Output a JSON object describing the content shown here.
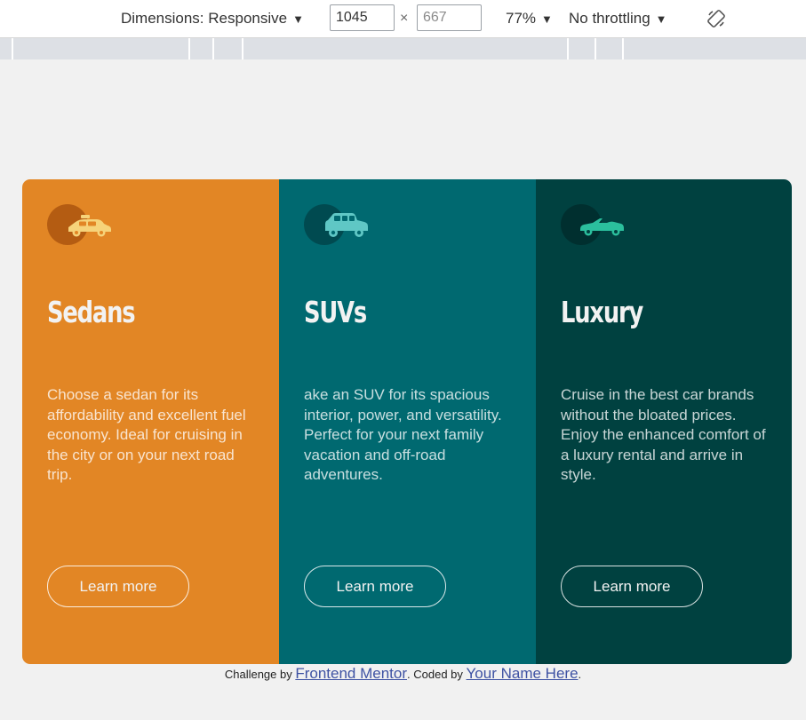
{
  "devtools": {
    "dimensions_label": "Dimensions: Responsive",
    "width_value": "1045",
    "height_placeholder": "667",
    "times": "×",
    "zoom": "77%",
    "throttling": "No throttling",
    "caret": "▼"
  },
  "cards": [
    {
      "icon": "sedan-car-icon",
      "title": "Sedans",
      "text": "Choose a sedan for its affordability and excellent fuel economy. Ideal for cruising in the city or on your next road trip.",
      "button": "Learn more",
      "color": "#e28625"
    },
    {
      "icon": "suv-car-icon",
      "title": "SUVs",
      "text": "ake an SUV for its spacious interior, power, and versatility. Perfect for your next family vacation and off-road adventures.",
      "button": "Learn more",
      "color": "#006970"
    },
    {
      "icon": "convertible-car-icon",
      "title": "Luxury",
      "text": "Cruise in the best car brands without the bloated prices. Enjoy the enhanced comfort of a luxury rental and arrive in style.",
      "button": "Learn more",
      "color": "#004140"
    }
  ],
  "attribution": {
    "prefix": "Challenge by ",
    "link1": "Frontend Mentor",
    "middle": ". Coded by ",
    "link2": "Your Name Here",
    "suffix": "."
  }
}
